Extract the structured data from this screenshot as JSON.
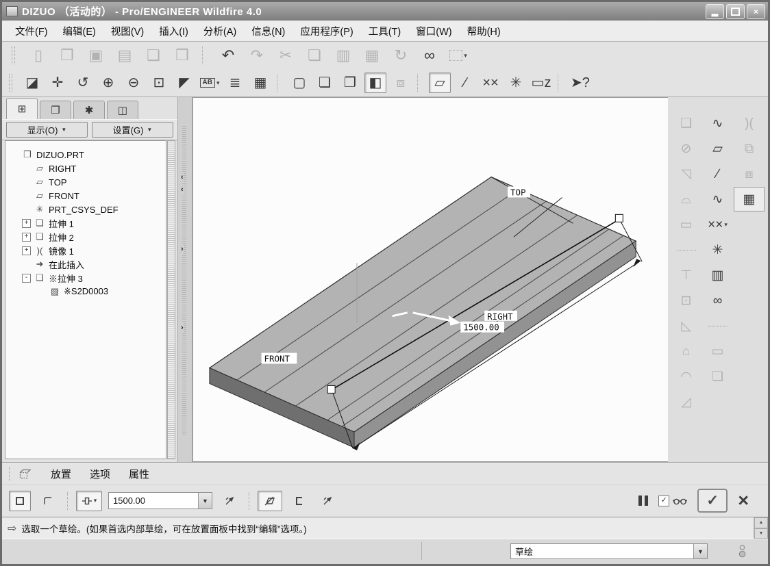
{
  "window": {
    "title": "DIZUO （活动的） - Pro/ENGINEER Wildfire 4.0",
    "minimize_glyph": "▂",
    "close_glyph": "×"
  },
  "menu_bar": {
    "items": [
      {
        "name": "menu-file",
        "label": "文件(F)"
      },
      {
        "name": "menu-edit",
        "label": "编辑(E)"
      },
      {
        "name": "menu-view",
        "label": "视图(V)"
      },
      {
        "name": "menu-insert",
        "label": "插入(I)"
      },
      {
        "name": "menu-analysis",
        "label": "分析(A)"
      },
      {
        "name": "menu-info",
        "label": "信息(N)"
      },
      {
        "name": "menu-applications",
        "label": "应用程序(P)"
      },
      {
        "name": "menu-tools",
        "label": "工具(T)"
      },
      {
        "name": "menu-window",
        "label": "窗口(W)"
      },
      {
        "name": "menu-help",
        "label": "帮助(H)"
      }
    ]
  },
  "toolbar_top": {
    "icons": [
      {
        "name": "new-file-icon",
        "glyph": "▯",
        "cls": "lite"
      },
      {
        "name": "open-file-icon",
        "glyph": "❐",
        "cls": "lite"
      },
      {
        "name": "save-file-icon",
        "glyph": "▣",
        "cls": "lite"
      },
      {
        "name": "print-icon",
        "glyph": "▤",
        "cls": "lite"
      },
      {
        "name": "save-copy-icon",
        "glyph": "❑",
        "cls": "lite"
      },
      {
        "name": "erase-icon",
        "glyph": "❒",
        "cls": "lite"
      },
      {
        "cls": "sep",
        "inter": "false"
      },
      {
        "name": "undo-icon",
        "glyph": "↶",
        "cls": "dark"
      },
      {
        "name": "redo-icon",
        "glyph": "↷",
        "cls": "lite"
      },
      {
        "name": "cut-icon",
        "glyph": "✂",
        "cls": "lite"
      },
      {
        "name": "copy-icon",
        "glyph": "❏",
        "cls": "lite"
      },
      {
        "name": "paste-icon",
        "glyph": "▥",
        "cls": "lite"
      },
      {
        "name": "paste-special-icon",
        "glyph": "▦",
        "cls": "lite"
      },
      {
        "name": "regenerate-icon",
        "glyph": "↻",
        "cls": "lite"
      },
      {
        "name": "find-icon",
        "glyph": "∞",
        "cls": "dark"
      },
      {
        "name": "select-box-icon",
        "glyph": "",
        "cls": "lite dashedbox dd"
      }
    ]
  },
  "toolbar_view": {
    "icons": [
      {
        "name": "repaint-icon",
        "glyph": "◪",
        "cls": "dark"
      },
      {
        "name": "spin-center-icon",
        "glyph": "✛",
        "cls": "dark"
      },
      {
        "name": "orient-mode-icon",
        "glyph": "↺",
        "cls": "dark"
      },
      {
        "name": "zoom-in-icon",
        "glyph": "⊕",
        "cls": "dark"
      },
      {
        "name": "zoom-out-icon",
        "glyph": "⊖",
        "cls": "dark"
      },
      {
        "name": "refit-icon",
        "glyph": "⊡",
        "cls": "dark"
      },
      {
        "name": "reorient-icon",
        "glyph": "◤",
        "cls": "dark"
      },
      {
        "name": "saved-views-icon",
        "glyph": "AB",
        "cls": "dark boxedg dd"
      },
      {
        "name": "layers-icon",
        "glyph": "≣",
        "cls": "dark"
      },
      {
        "name": "view-manager-icon",
        "glyph": "▦",
        "cls": "dark"
      },
      {
        "cls": "sep",
        "inter": "false"
      },
      {
        "name": "wireframe-icon",
        "glyph": "▢",
        "cls": "dark"
      },
      {
        "name": "hidden-line-icon",
        "glyph": "❏",
        "cls": "dark"
      },
      {
        "name": "no-hidden-icon",
        "glyph": "❐",
        "cls": "dark"
      },
      {
        "name": "shaded-icon",
        "glyph": "◧",
        "cls": "dark pressed"
      },
      {
        "name": "model-tree-toggle-icon",
        "glyph": "⧈",
        "cls": "lite"
      },
      {
        "cls": "sep",
        "inter": "false"
      },
      {
        "name": "datum-planes-toggle-icon",
        "glyph": "▱",
        "cls": "dark pressed"
      },
      {
        "name": "datum-axes-toggle-icon",
        "glyph": "∕",
        "cls": "dark"
      },
      {
        "name": "datum-points-toggle-icon",
        "glyph": "××",
        "cls": "dark"
      },
      {
        "name": "csys-toggle-icon",
        "glyph": "✳",
        "cls": "dark"
      },
      {
        "name": "annotations-toggle-icon",
        "glyph": "▭z",
        "cls": "dark"
      },
      {
        "cls": "sep",
        "inter": "false"
      },
      {
        "name": "context-help-icon",
        "glyph": "➤?",
        "cls": "dark"
      }
    ]
  },
  "navigator": {
    "tabs": [
      {
        "name": "model-tree-tab",
        "glyph": "⊞",
        "cls": "active"
      },
      {
        "name": "folder-browser-tab",
        "glyph": "❐"
      },
      {
        "name": "favorites-tab",
        "glyph": "✱"
      },
      {
        "name": "connections-tab",
        "glyph": "◫"
      }
    ],
    "show_button_label": "显示(O)",
    "settings_button_label": "设置(G)",
    "dropdown_arrow": "▼",
    "tree": [
      {
        "name": "tree-item-part",
        "icon": "part-icon",
        "glyph": "❒",
        "label": "DIZUO.PRT",
        "cls": "ind0"
      },
      {
        "name": "tree-item-right",
        "icon": "datum-plane-icon",
        "glyph": "▱",
        "label": "RIGHT",
        "cls": "ind1"
      },
      {
        "name": "tree-item-top",
        "icon": "datum-plane-icon",
        "glyph": "▱",
        "label": "TOP",
        "cls": "ind1"
      },
      {
        "name": "tree-item-front",
        "icon": "datum-plane-icon",
        "glyph": "▱",
        "label": "FRONT",
        "cls": "ind1"
      },
      {
        "name": "tree-item-csys",
        "icon": "csys-icon",
        "glyph": "✳",
        "label": "PRT_CSYS_DEF",
        "cls": "ind1"
      },
      {
        "name": "tree-item-extrude-1",
        "icon": "extrude-icon",
        "glyph": "❏",
        "label": "拉伸 1",
        "expander": "+",
        "cls": "ind1"
      },
      {
        "name": "tree-item-extrude-2",
        "icon": "extrude-icon",
        "glyph": "❏",
        "label": "拉伸 2",
        "expander": "+",
        "cls": "ind1"
      },
      {
        "name": "tree-item-mirror-1",
        "icon": "mirror-icon",
        "glyph": ")(",
        "label": "镜像 1",
        "expander": "+",
        "cls": "ind1"
      },
      {
        "name": "tree-item-insert-here",
        "icon": "insert-here-icon",
        "glyph": "➜",
        "label": "在此插入",
        "cls": "ind1"
      },
      {
        "name": "tree-item-extrude-3",
        "icon": "extrude-icon",
        "glyph": "❏",
        "label": "※拉伸 3",
        "expander": "-",
        "cls": "ind1"
      },
      {
        "name": "tree-item-sketch",
        "icon": "sketch-icon",
        "glyph": "▨",
        "label": "※S2D0003",
        "cls": "ind2"
      }
    ]
  },
  "viewport": {
    "labels": {
      "top": "TOP",
      "front": "FRONT",
      "right": "RIGHT"
    },
    "dimension": "1500.00"
  },
  "feature_toolbar": {
    "icons": [
      {
        "name": "extrude-icon",
        "glyph": "❏",
        "cls": "lite"
      },
      {
        "name": "style-icon",
        "glyph": "∿",
        "cls": "dark"
      },
      {
        "name": "merge-icon",
        "glyph": ")(",
        "cls": "lite"
      },
      {
        "name": "revolve-icon",
        "glyph": "⊘",
        "cls": "lite"
      },
      {
        "name": "datum-plane-icon",
        "glyph": "▱",
        "cls": "dark"
      },
      {
        "name": "trim-icon",
        "glyph": "⧉",
        "cls": "lite"
      },
      {
        "name": "sweep-icon",
        "glyph": "◹",
        "cls": "lite"
      },
      {
        "name": "datum-axis-icon",
        "glyph": "∕",
        "cls": "dark"
      },
      {
        "name": "extend-icon",
        "glyph": "⧈",
        "cls": "lite"
      },
      {
        "name": "boundary-blend-icon",
        "glyph": "⌓",
        "cls": "lite"
      },
      {
        "name": "datum-curve-icon",
        "glyph": "∿",
        "cls": "dark"
      },
      {
        "name": "pattern-icon",
        "glyph": "▦",
        "cls": "dark boxed"
      },
      {
        "name": "fill-icon",
        "glyph": "▭",
        "cls": "lite"
      },
      {
        "name": "datum-point-icon",
        "glyph": "××",
        "cls": "dark dd"
      },
      {
        "cls": "blank",
        "inter": "false"
      },
      {
        "cls": "hsep",
        "inter": "false"
      },
      {
        "name": "csys-icon",
        "glyph": "✳",
        "cls": "dark"
      },
      {
        "cls": "blank",
        "inter": "false"
      },
      {
        "name": "project-icon",
        "glyph": "⊤",
        "cls": "lite"
      },
      {
        "name": "measure-icon",
        "glyph": "▥",
        "cls": "dark"
      },
      {
        "cls": "blank",
        "inter": "false"
      },
      {
        "name": "offset-icon",
        "glyph": "⊡",
        "cls": "lite"
      },
      {
        "name": "link-icon",
        "glyph": "∞",
        "cls": "dark"
      },
      {
        "cls": "blank",
        "inter": "false"
      },
      {
        "name": "draft-icon",
        "glyph": "◺",
        "cls": "lite"
      },
      {
        "cls": "hsep",
        "inter": "false"
      },
      {
        "cls": "blank",
        "inter": "false"
      },
      {
        "name": "shell-icon",
        "glyph": "⌂",
        "cls": "lite"
      },
      {
        "name": "note-icon",
        "glyph": "▭",
        "cls": "lite"
      },
      {
        "cls": "blank",
        "inter": "false"
      },
      {
        "name": "rib-icon",
        "glyph": "◠",
        "cls": "lite"
      },
      {
        "name": "note-stack-icon",
        "glyph": "❏",
        "cls": "lite"
      },
      {
        "cls": "blank",
        "inter": "false"
      },
      {
        "name": "chamfer-icon",
        "glyph": "◿",
        "cls": "lite"
      },
      {
        "cls": "blank",
        "inter": "false"
      },
      {
        "cls": "blank",
        "inter": "false"
      }
    ]
  },
  "dashboard": {
    "tabs": [
      {
        "name": "tab-placement",
        "label": "放置"
      },
      {
        "name": "tab-options",
        "label": "选项"
      },
      {
        "name": "tab-properties",
        "label": "属性"
      }
    ],
    "depth_value": "1500.00",
    "combo_arrow": "▼",
    "check_glyph": "✓",
    "ok_glyph": "✓",
    "cancel_glyph": "×"
  },
  "message_area": {
    "prompt_icon": "⇨",
    "prompt": "选取一个草绘。(如果首选内部草绘，可在放置面板中找到“编辑”选项。)"
  },
  "status_bar": {
    "selection_filter": "草绘",
    "combo_arrow": "▼"
  }
}
